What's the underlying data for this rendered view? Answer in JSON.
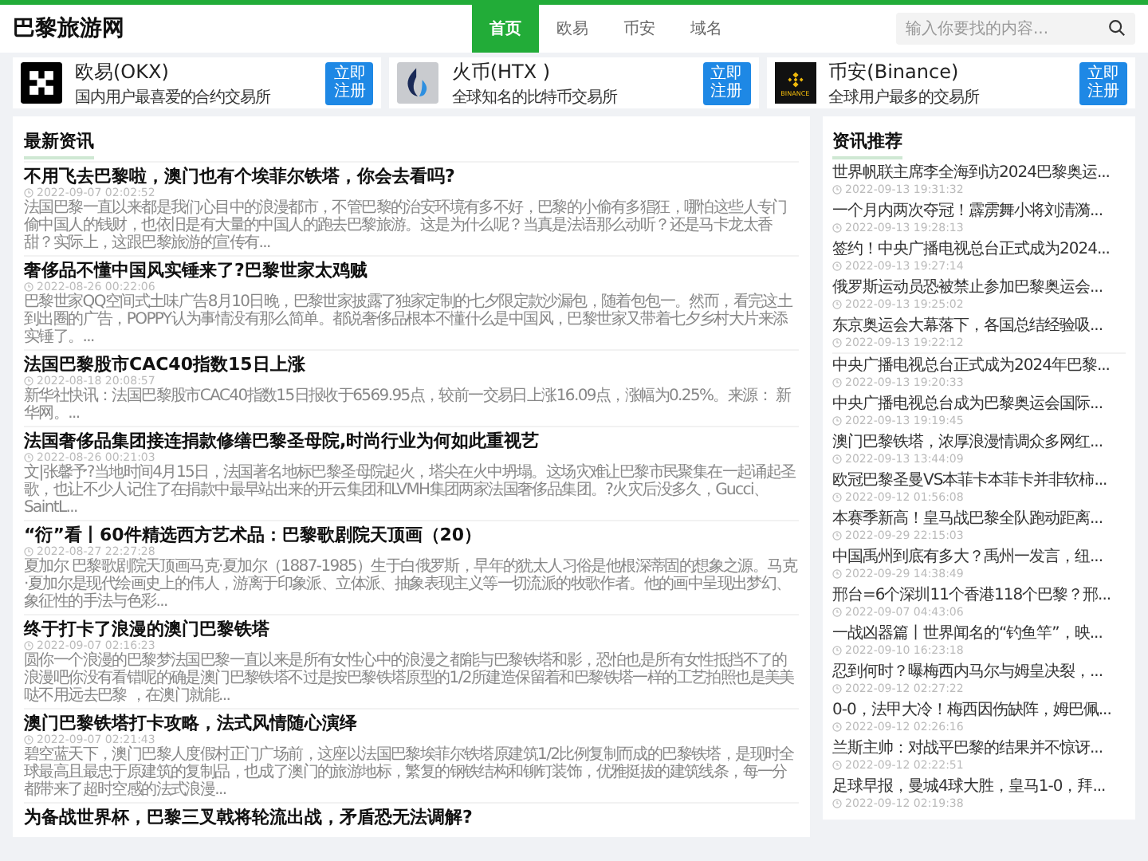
{
  "header": {
    "site_title": "巴黎旅游网",
    "nav": [
      {
        "label": "首页",
        "selected": true
      },
      {
        "label": "欧易",
        "selected": false
      },
      {
        "label": "币安",
        "selected": false
      },
      {
        "label": "域名",
        "selected": false
      }
    ],
    "search": {
      "placeholder": "输入你要找的内容..."
    }
  },
  "exchanges": [
    {
      "kind": "okx",
      "name": "欧易(OKX)",
      "tagline": "国内用户最喜爱的合约交易所",
      "button": "立即注册"
    },
    {
      "kind": "htx",
      "name": "火币(HTX )",
      "tagline": "全球知名的比特币交易所",
      "button": "立即注册"
    },
    {
      "kind": "binance",
      "name": "币安(Binance)",
      "tagline": "全球用户最多的交易所",
      "button": "立即注册",
      "logo_text": "BINANCE"
    }
  ],
  "news": {
    "heading": "最新资讯",
    "items": [
      {
        "title": "不用飞去巴黎啦，澳门也有个埃菲尔铁塔，你会去看吗?",
        "date": "2022-09-07 02:02:52",
        "summary": "法国巴黎一直以来都是我们心目中的浪漫都市，不管巴黎的治安环境有多不好，巴黎的小偷有多猖狂，哪怕这些人专门偷中国人的钱财，也依旧是有大量的中国人的跑去巴黎旅游。这是为什么呢？当真是法语那么动听？还是马卡龙太香甜？实际上，这跟巴黎旅游的宣传有..."
      },
      {
        "title": "奢侈品不懂中国风实锤来了?巴黎世家太鸡贼",
        "date": "2022-08-26 00:22:06",
        "summary": "巴黎世家QQ空间式土味广告8月10日晚，巴黎世家披露了独家定制的七夕限定款沙漏包，随着包包一。然而，看完这土到出圈的广告，POPPY认为事情没有那么简单。都说奢侈品根本不懂什么是中国风，巴黎世家又带着七夕乡村大片来添实锤了。..."
      },
      {
        "title": "法国巴黎股市CAC40指数15日上涨",
        "date": "2022-08-18 20:08:57",
        "summary": "新华社快讯：法国巴黎股市CAC40指数15日报收于6569.95点，较前一交易日上涨16.09点，涨幅为0.25%。来源： 新华网。..."
      },
      {
        "title": "法国奢侈品集团接连捐款修缮巴黎圣母院,时尚行业为何如此重视艺",
        "date": "2022-08-26 00:21:03",
        "summary": "文|张馨予?当地时间4月15日，法国著名地标巴黎圣母院起火，塔尖在火中坍塌。这场灾难让巴黎市民聚集在一起诵起圣歌，也让不少人记住了在捐款中最早站出来的开云集团和LVMH集团两家法国奢侈品集团。?火灾后没多久，Gucci、SaintL..."
      },
      {
        "title": "“衍”看丨60件精选西方艺术品：巴黎歌剧院天顶画（20）",
        "date": "2022-08-27 22:27:28",
        "summary": "夏加尔 巴黎歌剧院天顶画马克·夏加尔（1887-1985）生于白俄罗斯，早年的犹太人习俗是他根深蒂固的想象之源。马克·夏加尔是现代绘画史上的伟人，游离于印象派、立体派、抽象表现主义等一切流派的牧歌作者。他的画中呈现出梦幻、象征性的手法与色彩..."
      },
      {
        "title": "终于打卡了浪漫的澳门巴黎铁塔",
        "date": "2022-09-07 02:16:23",
        "summary": "圆你一个浪漫的巴黎梦法国巴黎一直以来是所有女性心中的浪漫之都能与巴黎铁塔和影，恐怕也是所有女性抵挡不了的浪漫吧你没有看错呢的确是澳门巴黎铁塔不过是按巴黎铁塔原型的1/2所建造保留着和巴黎铁塔一样的工艺拍照也是美美哒不用远去巴黎 ，在澳门就能..."
      },
      {
        "title": "澳门巴黎铁塔打卡攻略，法式风情随心演绎",
        "date": "2022-09-07 02:21:43",
        "summary": "碧空蓝天下，澳门巴黎人度假村正门广场前，这座以法国巴黎埃菲尔铁塔原建筑1/2比例复制而成的巴黎铁塔，是现时全球最高且最忠于原建筑的复制品，也成了澳门的旅游地标，繁复的钢铁结构和铆钉装饰，优雅挺拔的建筑线条，每一分都带来了超时空感的法式浪漫..."
      },
      {
        "title": "为备战世界杯，巴黎三叉戟将轮流出战，矛盾恐无法调解?"
      }
    ]
  },
  "recommended": {
    "heading": "资讯推荐",
    "items": [
      {
        "title": "世界帆联主席李全海到访2024巴黎奥运...",
        "date": "2022-09-13 19:31:32"
      },
      {
        "title": "一个月内两次夺冠！霹雳舞小将刘清漪...",
        "date": "2022-09-13 19:28:13"
      },
      {
        "title": "签约！中央广播电视总台正式成为2024...",
        "date": "2022-09-13 19:27:14"
      },
      {
        "title": "俄罗斯运动员恐被禁止参加巴黎奥运会...",
        "date": "2022-09-13 19:25:02"
      },
      {
        "title": "东京奥运会大幕落下，各国总结经验吸...",
        "date": "2022-09-13 19:22:12"
      },
      {
        "title": "中央广播电视总台正式成为2024年巴黎...",
        "date": "2022-09-13 19:20:33"
      },
      {
        "title": "中央广播电视总台成为巴黎奥运会国际...",
        "date": "2022-09-13 19:19:45"
      },
      {
        "title": "澳门巴黎铁塔，浓厚浪漫情调众多网红...",
        "date": "2022-09-13 13:44:09"
      },
      {
        "title": "欧冠巴黎圣曼VS本菲卡本菲卡并非软柿...",
        "date": "2022-09-12 01:56:08"
      },
      {
        "title": "本赛季新高！皇马战巴黎全队跑动距离...",
        "date": "2022-09-29 22:15:03"
      },
      {
        "title": "中国禹州到底有多大？禹州一发言，纽...",
        "date": "2022-09-29 14:38:49"
      },
      {
        "title": "邢台=6个深圳11个香港118个巴黎？邢...",
        "date": "2022-09-07 04:43:06"
      },
      {
        "title": "一战凶器篇丨世界闻名的“钓鱼竿”，映...",
        "date": "2022-09-10 16:23:18"
      },
      {
        "title": "忍到何时？曝梅西内马尔与姆皇决裂，...",
        "date": "2022-09-12 02:27:22"
      },
      {
        "title": "0-0，法甲大冷！梅西因伤缺阵，姆巴佩...",
        "date": "2022-09-12 02:26:16"
      },
      {
        "title": "兰斯主帅：对战平巴黎的结果并不惊讶...",
        "date": "2022-09-12 02:22:51"
      },
      {
        "title": "足球早报，曼城4球大胜，皇马1-0，拜...",
        "date": "2022-09-12 02:19:38"
      }
    ]
  }
}
